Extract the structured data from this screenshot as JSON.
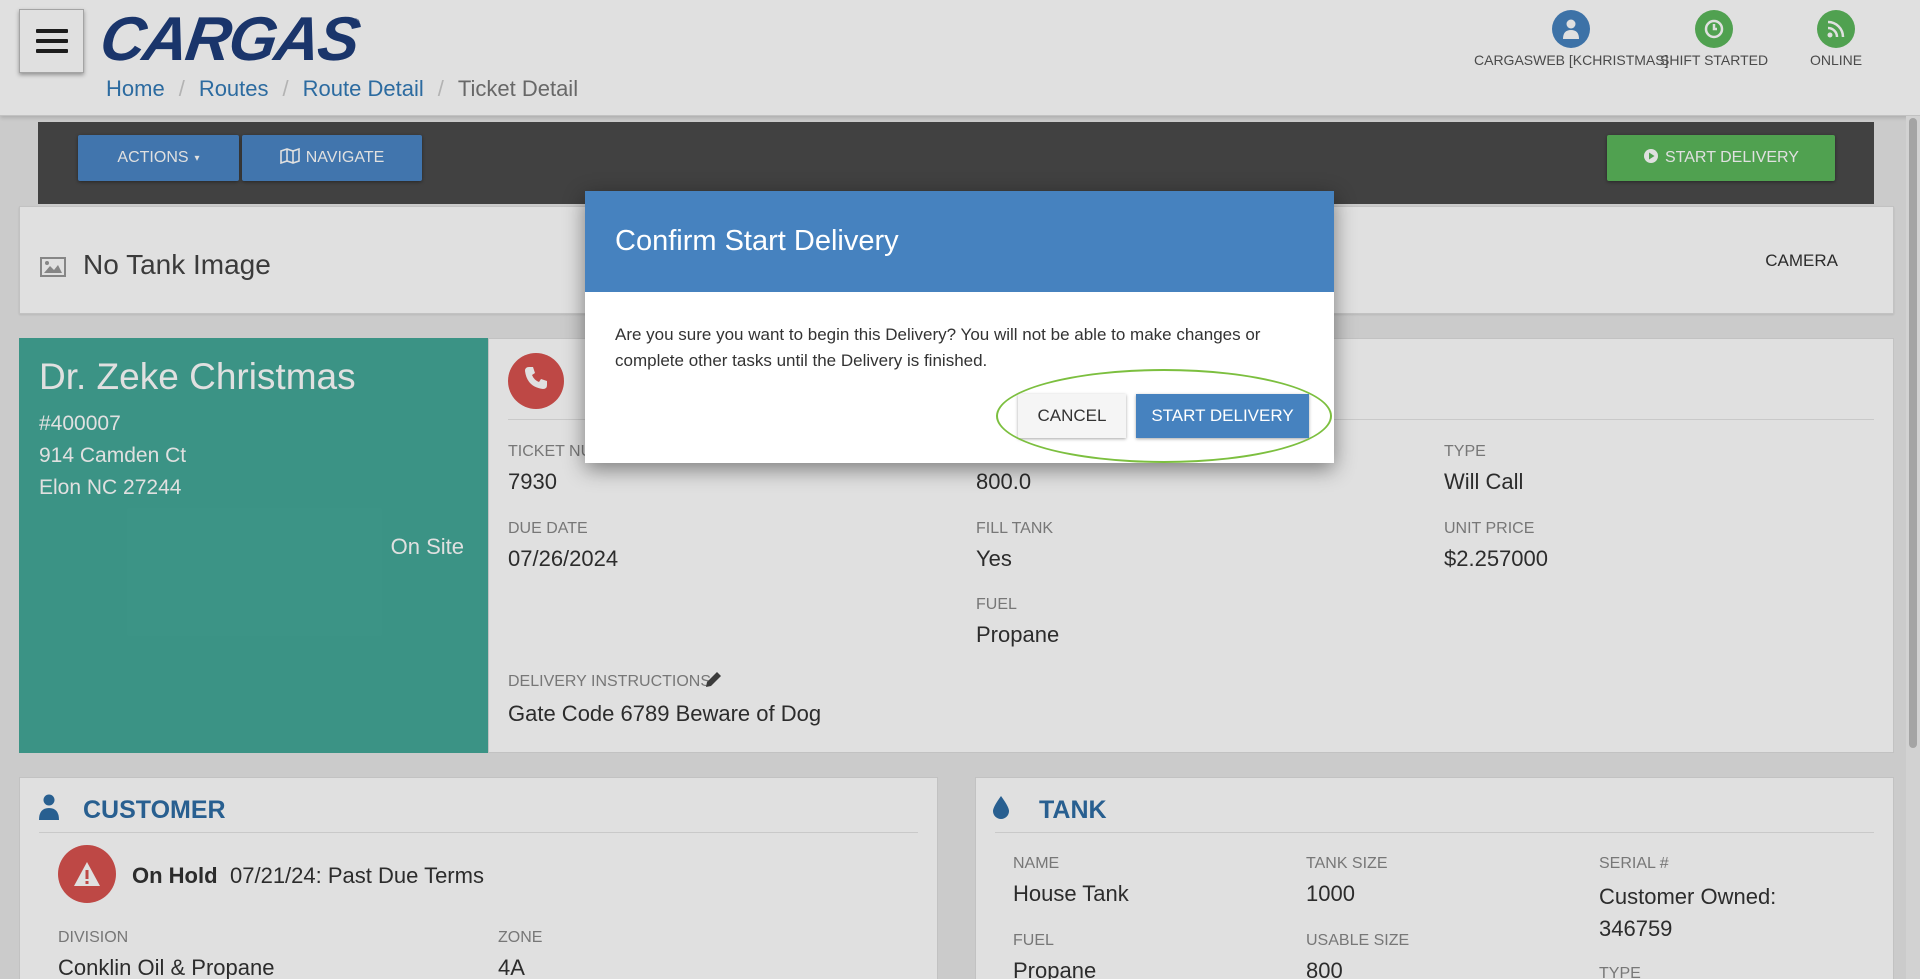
{
  "header": {
    "logo": "CARGAS",
    "logo_mark": "®",
    "breadcrumb": [
      "Home",
      "Routes",
      "Route Detail",
      "Ticket Detail"
    ],
    "user": "CARGASWEB [KCHRISTMAS]",
    "shift": "SHIFT STARTED",
    "connection": "ONLINE"
  },
  "toolbar": {
    "actions_label": "ACTIONS",
    "navigate_label": "NAVIGATE",
    "start_delivery_label": "START DELIVERY"
  },
  "tank_image": {
    "label": "No Tank Image",
    "camera_label": "CAMERA"
  },
  "customer_card": {
    "name": "Dr. Zeke Christmas",
    "account": "#400007",
    "street": "914 Camden Ct",
    "city": "Elon NC 27244",
    "status": "On Site"
  },
  "ticket": {
    "ticket_number_label": "TICKET NU",
    "ticket_number": "7930",
    "amount": "800.0",
    "type_label": "TYPE",
    "type": "Will Call",
    "due_date_label": "DUE DATE",
    "due_date": "07/26/2024",
    "fill_tank_label": "FILL TANK",
    "fill_tank": "Yes",
    "unit_price_label": "UNIT PRICE",
    "unit_price": "$2.257000",
    "fuel_label": "FUEL",
    "fuel": "Propane",
    "instructions_label": "DELIVERY INSTRUCTIONS",
    "instructions": "Gate Code 6789 Beware of Dog"
  },
  "customer_panel": {
    "title": "CUSTOMER",
    "hold_label": "On Hold",
    "hold_reason": "07/21/24: Past Due Terms",
    "division_label": "DIVISION",
    "division": "Conklin Oil & Propane",
    "zone_label": "ZONE",
    "zone": "4A"
  },
  "tank_panel": {
    "title": "TANK",
    "name_label": "NAME",
    "name": "House Tank",
    "size_label": "TANK SIZE",
    "size": "1000",
    "serial_label": "SERIAL #",
    "serial": "Customer Owned: 346759",
    "fuel_label": "FUEL",
    "fuel": "Propane",
    "usable_label": "USABLE SIZE",
    "usable": "800",
    "type_label": "TYPE"
  },
  "modal": {
    "title": "Confirm Start Delivery",
    "message": "Are you sure you want to begin this Delivery? You will not be able to make changes or complete other tasks until the Delivery is finished.",
    "cancel_label": "CANCEL",
    "confirm_label": "START DELIVERY"
  },
  "colors": {
    "brand": "#1e3d7a",
    "primary": "#4682bf",
    "success": "#5cb85c",
    "customer_card": "#44a898",
    "danger": "#d9534f",
    "highlight": "#7cbf3f"
  }
}
